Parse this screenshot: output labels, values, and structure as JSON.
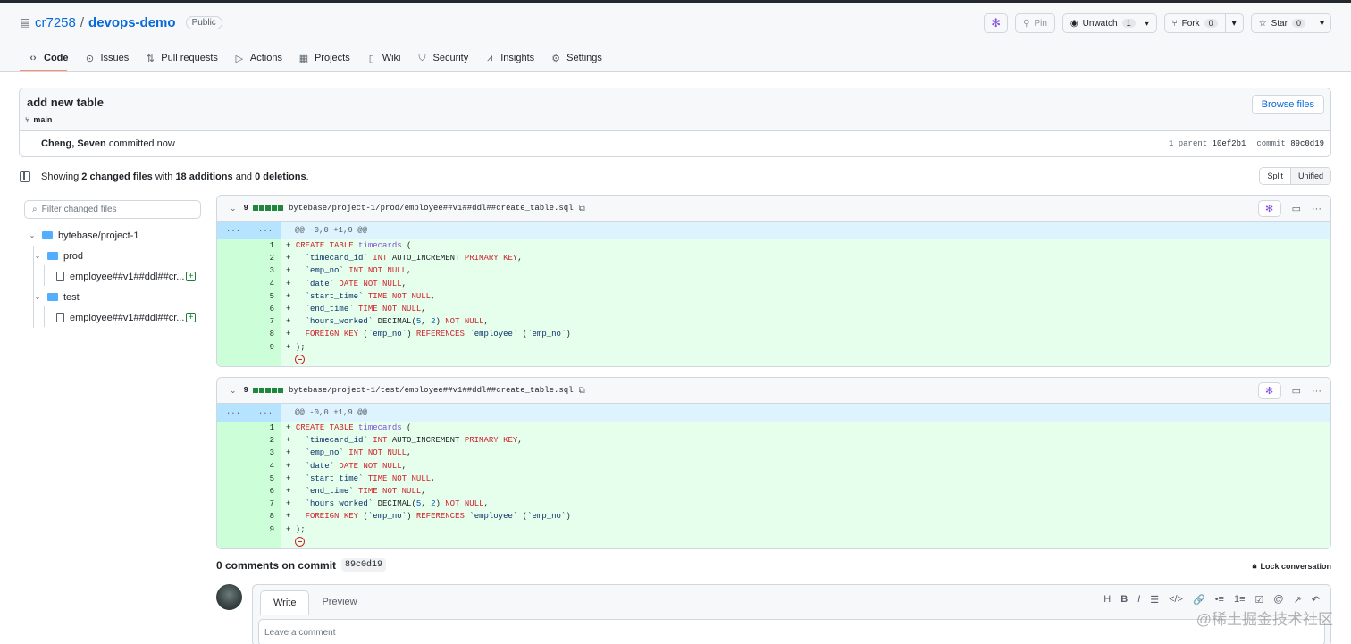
{
  "repo": {
    "owner": "cr7258",
    "name": "devops-demo",
    "visibility": "Public"
  },
  "header_buttons": {
    "pin": "Pin",
    "unwatch": "Unwatch",
    "unwatch_count": "1",
    "fork": "Fork",
    "fork_count": "0",
    "star": "Star",
    "star_count": "0"
  },
  "tabs": [
    "Code",
    "Issues",
    "Pull requests",
    "Actions",
    "Projects",
    "Wiki",
    "Security",
    "Insights",
    "Settings"
  ],
  "commit": {
    "message": "add new table",
    "branch": "main",
    "author": "Cheng, Seven",
    "time": "committed now",
    "parent_label": "1 parent",
    "parent_sha": "10ef2b1",
    "commit_label": "commit",
    "commit_sha": "89c0d19",
    "browse_files": "Browse files"
  },
  "summary": {
    "prefix": "Showing",
    "changed": "2 changed files",
    "with": "with",
    "additions": "18 additions",
    "and": "and",
    "deletions": "0 deletions",
    "period": ".",
    "split": "Split",
    "unified": "Unified"
  },
  "file_filter_placeholder": "Filter changed files",
  "tree": {
    "root": "bytebase/project-1",
    "folders": [
      {
        "name": "prod",
        "file": "employee##v1##ddl##cr..."
      },
      {
        "name": "test",
        "file": "employee##v1##ddl##cr..."
      }
    ]
  },
  "diffs": [
    {
      "count": "9",
      "path": "bytebase/project-1/prod/employee##v1##ddl##create_table.sql",
      "hunk": "@@ -0,0 +1,9 @@",
      "hunk_left": "...",
      "hunk_right": "..."
    },
    {
      "count": "9",
      "path": "bytebase/project-1/test/employee##v1##ddl##create_table.sql",
      "hunk": "@@ -0,0 +1,9 @@",
      "hunk_left": "...",
      "hunk_right": "..."
    }
  ],
  "code_lines": [
    "+ CREATE TABLE timecards (",
    "+   `timecard_id` INT AUTO_INCREMENT PRIMARY KEY,",
    "+   `emp_no` INT NOT NULL,",
    "+   `date` DATE NOT NULL,",
    "+   `start_time` TIME NOT NULL,",
    "+   `end_time` TIME NOT NULL,",
    "+   `hours_worked` DECIMAL(5, 2) NOT NULL,",
    "+   FOREIGN KEY (`emp_no`) REFERENCES `employee` (`emp_no`)",
    "+ );"
  ],
  "comments": {
    "title": "0 comments on commit",
    "sha": "89c0d19",
    "lock": "Lock conversation",
    "write_tab": "Write",
    "preview_tab": "Preview",
    "placeholder": "Leave a comment"
  },
  "toolbar_icons": [
    "H",
    "B",
    "I",
    "☰",
    "</>",
    "🔗",
    "•≡",
    "1≡",
    "☑",
    "@",
    "↗",
    "↶"
  ],
  "watermark": "@稀土掘金技术社区"
}
